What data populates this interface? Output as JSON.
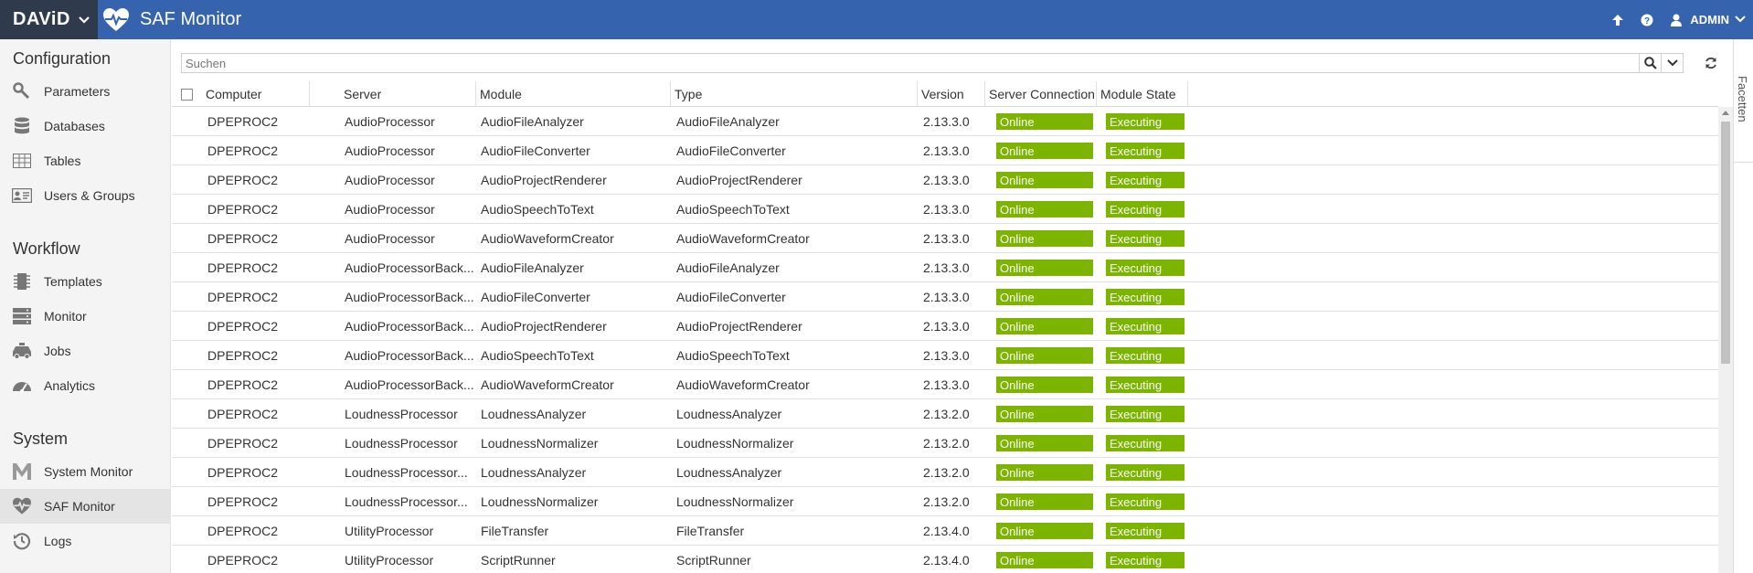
{
  "header": {
    "brand": "DAViD",
    "app_title": "SAF Monitor",
    "user": "ADMIN",
    "icons": [
      "upload-icon",
      "help-icon",
      "user-icon"
    ]
  },
  "sidebar": {
    "sections": [
      {
        "title": "Configuration",
        "items": [
          {
            "label": "Parameters",
            "icon": "wrench-icon"
          },
          {
            "label": "Databases",
            "icon": "database-icon"
          },
          {
            "label": "Tables",
            "icon": "table-icon"
          },
          {
            "label": "Users & Groups",
            "icon": "id-card-icon"
          }
        ]
      },
      {
        "title": "Workflow",
        "items": [
          {
            "label": "Templates",
            "icon": "chip-icon"
          },
          {
            "label": "Monitor",
            "icon": "server-icon"
          },
          {
            "label": "Jobs",
            "icon": "taxi-icon"
          },
          {
            "label": "Analytics",
            "icon": "gauge-icon"
          }
        ]
      },
      {
        "title": "System",
        "items": [
          {
            "label": "System Monitor",
            "icon": "m-logo-icon"
          },
          {
            "label": "SAF Monitor",
            "icon": "heartbeat-icon",
            "active": true
          },
          {
            "label": "Logs",
            "icon": "history-icon"
          }
        ]
      }
    ]
  },
  "search": {
    "placeholder": "Suchen",
    "value": ""
  },
  "facets_label": "Facetten",
  "table": {
    "columns": [
      "Computer",
      "Server",
      "Module",
      "Type",
      "Version",
      "Server Connection",
      "Module State"
    ],
    "rows": [
      [
        "DPEPROC2",
        "AudioProcessor",
        "AudioFileAnalyzer",
        "AudioFileAnalyzer",
        "2.13.3.0",
        "Online",
        "Executing"
      ],
      [
        "DPEPROC2",
        "AudioProcessor",
        "AudioFileConverter",
        "AudioFileConverter",
        "2.13.3.0",
        "Online",
        "Executing"
      ],
      [
        "DPEPROC2",
        "AudioProcessor",
        "AudioProjectRenderer",
        "AudioProjectRenderer",
        "2.13.3.0",
        "Online",
        "Executing"
      ],
      [
        "DPEPROC2",
        "AudioProcessor",
        "AudioSpeechToText",
        "AudioSpeechToText",
        "2.13.3.0",
        "Online",
        "Executing"
      ],
      [
        "DPEPROC2",
        "AudioProcessor",
        "AudioWaveformCreator",
        "AudioWaveformCreator",
        "2.13.3.0",
        "Online",
        "Executing"
      ],
      [
        "DPEPROC2",
        "AudioProcessorBack...",
        "AudioFileAnalyzer",
        "AudioFileAnalyzer",
        "2.13.3.0",
        "Online",
        "Executing"
      ],
      [
        "DPEPROC2",
        "AudioProcessorBack...",
        "AudioFileConverter",
        "AudioFileConverter",
        "2.13.3.0",
        "Online",
        "Executing"
      ],
      [
        "DPEPROC2",
        "AudioProcessorBack...",
        "AudioProjectRenderer",
        "AudioProjectRenderer",
        "2.13.3.0",
        "Online",
        "Executing"
      ],
      [
        "DPEPROC2",
        "AudioProcessorBack...",
        "AudioSpeechToText",
        "AudioSpeechToText",
        "2.13.3.0",
        "Online",
        "Executing"
      ],
      [
        "DPEPROC2",
        "AudioProcessorBack...",
        "AudioWaveformCreator",
        "AudioWaveformCreator",
        "2.13.3.0",
        "Online",
        "Executing"
      ],
      [
        "DPEPROC2",
        "LoudnessProcessor",
        "LoudnessAnalyzer",
        "LoudnessAnalyzer",
        "2.13.2.0",
        "Online",
        "Executing"
      ],
      [
        "DPEPROC2",
        "LoudnessProcessor",
        "LoudnessNormalizer",
        "LoudnessNormalizer",
        "2.13.2.0",
        "Online",
        "Executing"
      ],
      [
        "DPEPROC2",
        "LoudnessProcessor...",
        "LoudnessAnalyzer",
        "LoudnessAnalyzer",
        "2.13.2.0",
        "Online",
        "Executing"
      ],
      [
        "DPEPROC2",
        "LoudnessProcessor...",
        "LoudnessNormalizer",
        "LoudnessNormalizer",
        "2.13.2.0",
        "Online",
        "Executing"
      ],
      [
        "DPEPROC2",
        "UtilityProcessor",
        "FileTransfer",
        "FileTransfer",
        "2.13.4.0",
        "Online",
        "Executing"
      ],
      [
        "DPEPROC2",
        "UtilityProcessor",
        "ScriptRunner",
        "ScriptRunner",
        "2.13.4.0",
        "Online",
        "Executing"
      ]
    ]
  },
  "colors": {
    "header_bg": "#3563ad",
    "brand_bg": "#2f3b4d",
    "status_green": "#7cb500"
  }
}
